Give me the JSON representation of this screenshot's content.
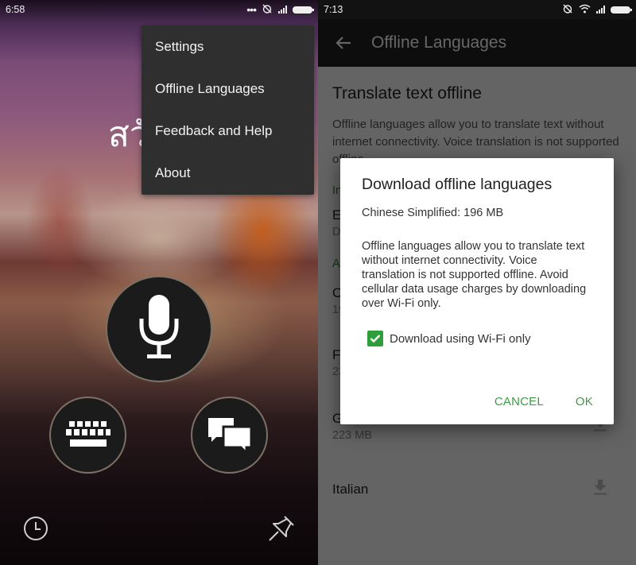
{
  "left_screen": {
    "status_bar": {
      "time": "6:58",
      "icons": [
        "more-dots-icon",
        "alarm-off-icon",
        "signal-icon",
        "battery-icon"
      ]
    },
    "partial_translation_text": "สวั",
    "overflow_menu": {
      "items": [
        {
          "label": "Settings"
        },
        {
          "label": "Offline Languages"
        },
        {
          "label": "Feedback and Help"
        },
        {
          "label": "About"
        }
      ]
    },
    "buttons": {
      "microphone": "microphone-icon",
      "keyboard": "keyboard-icon",
      "conversation": "conversation-icon",
      "history": "history-clock-icon",
      "pin": "pin-icon"
    }
  },
  "right_screen": {
    "status_bar": {
      "time": "7:13",
      "icons": [
        "alarm-off-icon",
        "wifi-icon",
        "signal-icon",
        "battery-icon"
      ]
    },
    "app_bar": {
      "back_icon": "arrow-back-icon",
      "title": "Offline Languages"
    },
    "content": {
      "section_title": "Translate text offline",
      "description": "Offline languages allow you to translate text without internet connectivity. Voice translation is not supported offline.",
      "installed_header": "Installed",
      "installed": [
        {
          "name": "English",
          "size": "Default"
        }
      ],
      "available_header": "Available",
      "available": [
        {
          "name": "Chinese Simplified",
          "size": "196 MB"
        },
        {
          "name": "French",
          "size": "230 MB"
        },
        {
          "name": "German",
          "size": "223 MB"
        },
        {
          "name": "Italian",
          "size": ""
        }
      ]
    },
    "dialog": {
      "title": "Download offline languages",
      "language_line": "Chinese Simplified: 196 MB",
      "body": "Offline languages allow you to translate text without internet connectivity. Voice translation is not supported offline. Avoid cellular data usage charges by downloading over Wi-Fi only.",
      "checkbox_label": "Download using Wi-Fi only",
      "checkbox_checked": true,
      "cancel_label": "CANCEL",
      "ok_label": "OK"
    },
    "colors": {
      "accent_green": "#3f9b45",
      "checkbox_green": "#2e9e3a",
      "app_bar": "#212121"
    }
  }
}
